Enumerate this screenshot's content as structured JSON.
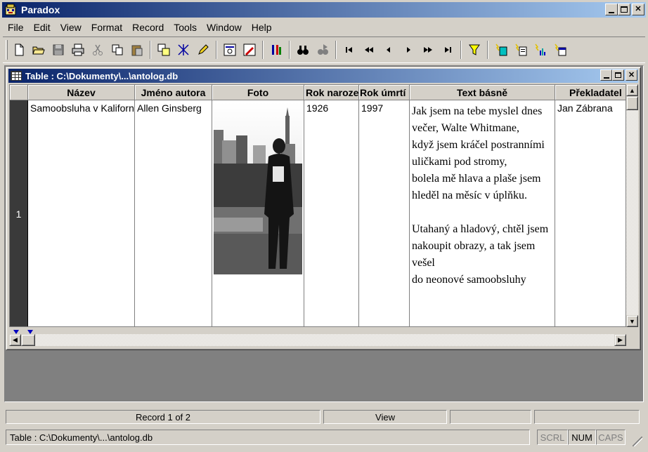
{
  "app": {
    "title": "Paradox"
  },
  "menu": [
    "File",
    "Edit",
    "View",
    "Format",
    "Record",
    "Tools",
    "Window",
    "Help"
  ],
  "child_window": {
    "title": "Table : C:\\Dokumenty\\...\\antolog.db"
  },
  "table": {
    "columns": [
      "Název",
      "Jméno autora",
      "Foto",
      "Rok narozen",
      "Rok úmrtí",
      "Text básně",
      "Překladatel"
    ],
    "row_number": "1",
    "row": {
      "nazev": "Samoobsluha v Kalifornii",
      "autor": "Allen Ginsberg",
      "rok_narozeni": "1926",
      "rok_umrti": "1997",
      "text_basne": "Jak jsem na tebe myslel dnes večer, Walte Whitmane,\nkdyž jsem kráčel postranními uličkami pod stromy,\nbolela mě hlava a plaše jsem hleděl na měsíc v úplňku.\n\nUtahaný a hladový, chtěl jsem nakoupit obrazy, a tak jsem vešel\ndo neonové samoobsluhy",
      "prekladatel": "Jan Zábrana"
    }
  },
  "status": {
    "record": "Record 1 of 2",
    "mode": "View",
    "path": "Table : C:\\Dokumenty\\...\\antolog.db",
    "indicators": [
      "SCRL",
      "NUM",
      "CAPS"
    ]
  },
  "indicator_state": {
    "SCRL": "off",
    "NUM": "on",
    "CAPS": "off"
  }
}
